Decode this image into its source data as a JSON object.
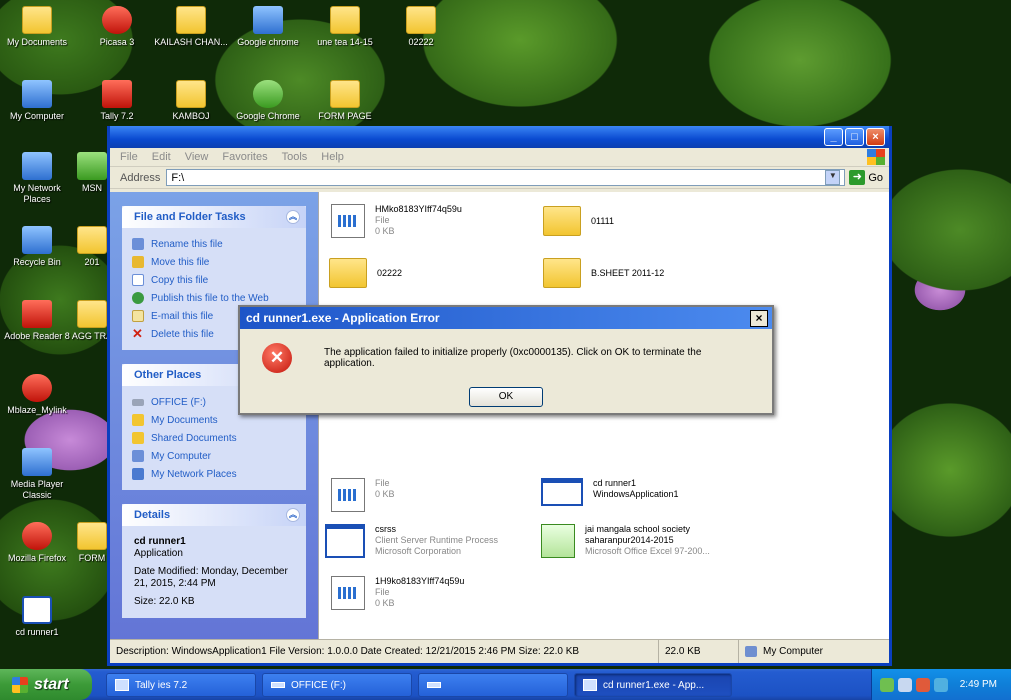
{
  "desktop": {
    "icons": [
      {
        "label": "My Documents"
      },
      {
        "label": "Picasa 3"
      },
      {
        "label": "KAILASH CHAN..."
      },
      {
        "label": "Google chrome"
      },
      {
        "label": "une tea 14-15"
      },
      {
        "label": "02222"
      },
      {
        "label": "My Computer"
      },
      {
        "label": "Tally 7.2"
      },
      {
        "label": "KAMBOJ"
      },
      {
        "label": "Google Chrome"
      },
      {
        "label": "FORM PAGE"
      },
      {
        "label": "My Network Places"
      },
      {
        "label": "MSN"
      },
      {
        "label": "Recycle Bin"
      },
      {
        "label": "201"
      },
      {
        "label": "Adobe Reader 8"
      },
      {
        "label": "AGG TRA"
      },
      {
        "label": "Mblaze_Mylink"
      },
      {
        "label": "Media Player Classic"
      },
      {
        "label": "Mozilla Firefox"
      },
      {
        "label": "FORM"
      },
      {
        "label": "cd runner1"
      }
    ]
  },
  "explorer": {
    "menu": [
      "File",
      "Edit",
      "View",
      "Favorites",
      "Tools",
      "Help"
    ],
    "address_label": "Address",
    "address_value": "F:\\",
    "go_label": "Go",
    "tasks": {
      "title": "File and Folder Tasks",
      "items": [
        "Rename this file",
        "Move this file",
        "Copy this file",
        "Publish this file to the Web",
        "E-mail this file",
        "Delete this file"
      ]
    },
    "other_places": {
      "title": "Other Places",
      "items": [
        "OFFICE (F:)",
        "My Documents",
        "Shared Documents",
        "My Computer",
        "My Network Places"
      ]
    },
    "details": {
      "title": "Details",
      "name": "cd runner1",
      "type": "Application",
      "modified": "Date Modified: Monday, December 21, 2015, 2:44 PM",
      "size": "Size: 22.0 KB"
    },
    "files": [
      {
        "name": "HMko8183YIff74q59u",
        "line2": "File",
        "line3": "0 KB"
      },
      {
        "name": "01111",
        "line2": "",
        "line3": ""
      },
      {
        "name": "02222",
        "line2": "",
        "line3": ""
      },
      {
        "name": "B.SHEET 2011-12",
        "line2": "",
        "line3": ""
      },
      {
        "name": "",
        "line2": "File",
        "line3": "0 KB"
      },
      {
        "name": "cd runner1",
        "line2": "WindowsApplication1",
        "line3": ""
      },
      {
        "name": "csrss",
        "line2": "Client Server Runtime Process",
        "line3": "Microsoft Corporation"
      },
      {
        "name": "jai mangala school society saharanpur2014-2015",
        "line2": "Microsoft Office Excel 97-200...",
        "line3": ""
      },
      {
        "name": "1H9ko8183YIff74q59u",
        "line2": "File",
        "line3": "0 KB"
      }
    ],
    "status": {
      "description": "Description: WindowsApplication1 File Version: 1.0.0.0 Date Created: 12/21/2015 2:46 PM Size: 22.0 KB",
      "size": "22.0 KB",
      "location": "My Computer"
    }
  },
  "dialog": {
    "title": "cd runner1.exe - Application Error",
    "message": "The application failed to initialize properly (0xc0000135). Click on OK to terminate the application.",
    "ok_label": "OK",
    "close_glyph": "×"
  },
  "taskbar": {
    "start_label": "start",
    "tasks": [
      {
        "label": "Tally ies 7.2"
      },
      {
        "label": "OFFICE (F:)"
      },
      {
        "label": ""
      },
      {
        "label": "cd runner1.exe - App..."
      }
    ],
    "clock": "2:49 PM"
  }
}
